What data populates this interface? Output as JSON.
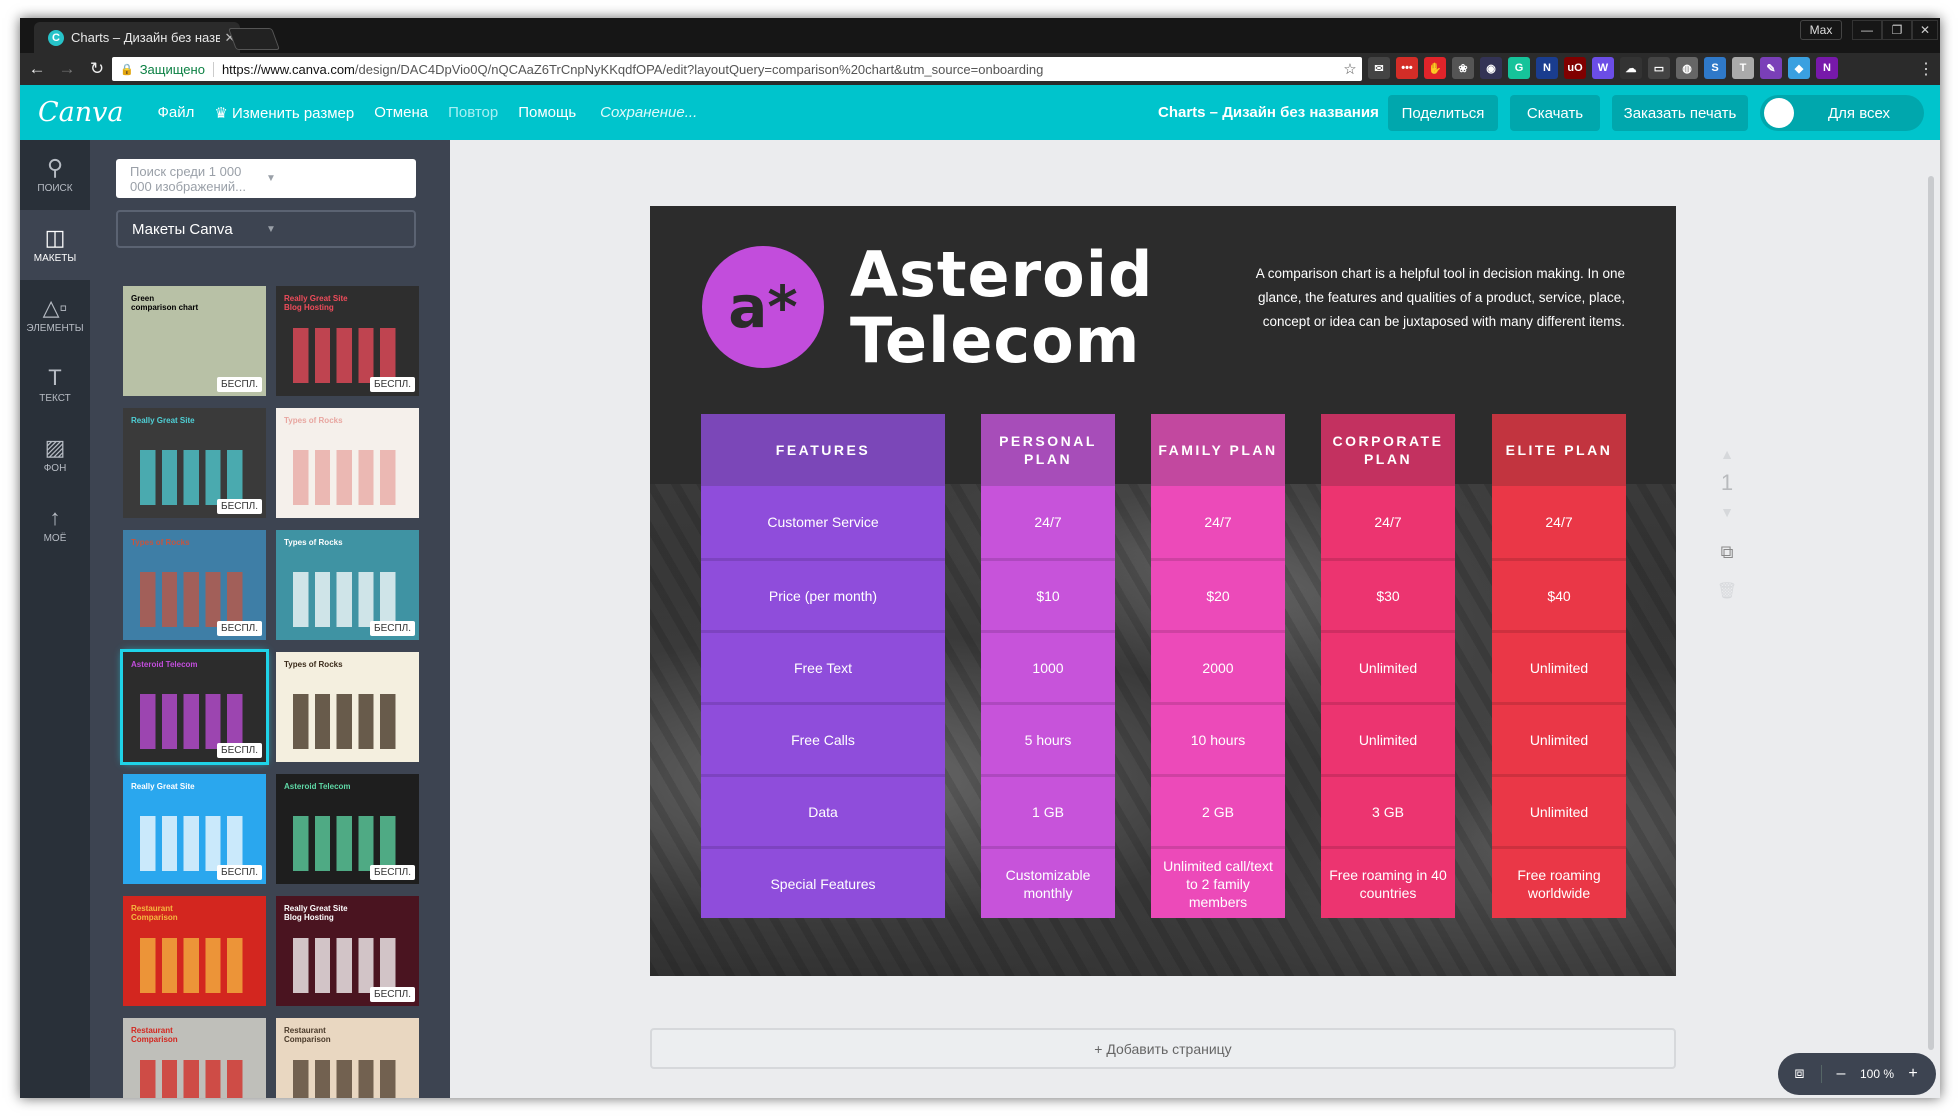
{
  "browser": {
    "tab_title": "Charts – Дизайн без назв",
    "tab_favicon": "C",
    "profile": "Max",
    "window_controls": [
      "minimize-icon",
      "restore-icon",
      "close-icon"
    ],
    "secure_label": "Защищено",
    "url_host": "https://www.canva.com",
    "url_path": "/design/DAC4DpVio0Q/nQCAaZ6TrCnpNyKKqdfOPA/edit?layoutQuery=comparison%20chart&utm_source=onboarding",
    "extensions": [
      {
        "name": "mail-ext-icon",
        "glyph": "✉",
        "color": "#444"
      },
      {
        "name": "lastpass-ext-icon",
        "glyph": "•••",
        "color": "#d32d27"
      },
      {
        "name": "adblock-ext-icon",
        "glyph": "✋",
        "color": "#e0242a"
      },
      {
        "name": "paw-ext-icon",
        "glyph": "❀",
        "color": "#555"
      },
      {
        "name": "spy-ext-icon",
        "glyph": "◉",
        "color": "#335"
      },
      {
        "name": "grammarly-ext-icon",
        "glyph": "G",
        "color": "#15c39a"
      },
      {
        "name": "n-ext-icon",
        "glyph": "N",
        "color": "#1a3d8f"
      },
      {
        "name": "ublock-ext-icon",
        "glyph": "uO",
        "color": "#800000"
      },
      {
        "name": "w-ext-icon",
        "glyph": "W",
        "color": "#6b4de6"
      },
      {
        "name": "cloud-ext-icon",
        "glyph": "☁",
        "color": "#333"
      },
      {
        "name": "window-ext-icon",
        "glyph": "▭",
        "color": "#444"
      },
      {
        "name": "globe-ext-icon",
        "glyph": "◍",
        "color": "#666"
      },
      {
        "name": "s-ext-icon",
        "glyph": "S",
        "color": "#2f79c9"
      },
      {
        "name": "t-ext-icon",
        "glyph": "T",
        "color": "#aaa"
      },
      {
        "name": "feather-ext-icon",
        "glyph": "✎",
        "color": "#7a3fb8"
      },
      {
        "name": "diamond-ext-icon",
        "glyph": "◆",
        "color": "#3aa0e0"
      },
      {
        "name": "onenote-ext-icon",
        "glyph": "N",
        "color": "#7719aa"
      }
    ]
  },
  "header": {
    "logo": "Canva",
    "menu": [
      "Файл",
      "Изменить размер",
      "Отмена",
      "Повтор",
      "Помощь"
    ],
    "status": "Сохранение...",
    "doc_title": "Charts – Дизайн без названия",
    "share": "Поделиться",
    "download": "Скачать",
    "print": "Заказать печать",
    "visibility": "Для всех"
  },
  "rail": [
    {
      "label": "ПОИСК",
      "icon": "search-icon",
      "glyph": "⚲"
    },
    {
      "label": "МАКЕТЫ",
      "icon": "layouts-icon",
      "glyph": "◫",
      "active": true
    },
    {
      "label": "ЭЛЕМЕНТЫ",
      "icon": "elements-icon",
      "glyph": "△▫"
    },
    {
      "label": "ТЕКСТ",
      "icon": "text-icon",
      "glyph": "T"
    },
    {
      "label": "ФОН",
      "icon": "background-icon",
      "glyph": "▨"
    },
    {
      "label": "МОЁ",
      "icon": "upload-icon",
      "glyph": "↑"
    }
  ],
  "panel": {
    "search_placeholder": "Поиск среди 1 000 000 изображений...",
    "dropdown": "Макеты Canva",
    "badge": "БЕСПЛ.",
    "templates": [
      {
        "title": "Green comparison chart",
        "bg": "#b8c1a6",
        "free": true
      },
      {
        "title": "Really Great Site Blog Hosting",
        "bg": "#2e2e2e",
        "accent": "#ef4c5b",
        "free": true
      },
      {
        "title": "Really Great Site",
        "bg": "#3a3a3a",
        "accent": "#4fd0d6",
        "free": true
      },
      {
        "title": "Types of Rocks",
        "bg": "#f5f0eb",
        "accent": "#e8a6a0",
        "free": false
      },
      {
        "title": "Types of Rocks",
        "bg": "#3e7ea6",
        "accent": "#c4553f",
        "free": true
      },
      {
        "title": "Types of Rocks",
        "bg": "#3f93a3",
        "accent": "#fff",
        "free": true
      },
      {
        "title": "Asteroid Telecom",
        "bg": "#2c2c2c",
        "accent": "#c24ddc",
        "free": true,
        "selected": true
      },
      {
        "title": "Types of Rocks",
        "bg": "#f4efdf",
        "accent": "#3a2a1a",
        "free": false
      },
      {
        "title": "Really Great Site",
        "bg": "#2aa7ee",
        "accent": "#fff",
        "free": true
      },
      {
        "title": "Asteroid Telecom",
        "bg": "#1e1e1e",
        "accent": "#5fd8a6",
        "free": true
      },
      {
        "title": "Restaurant Comparison",
        "bg": "#d3261f",
        "accent": "#f5b940",
        "free": false
      },
      {
        "title": "Really Great Site Blog Hosting",
        "bg": "#4a1420",
        "accent": "#fff",
        "free": true
      },
      {
        "title": "Restaurant Comparison",
        "bg": "#bfbfba",
        "accent": "#d3261f",
        "free": false
      },
      {
        "title": "Restaurant Comparison",
        "bg": "#e9d7c1",
        "accent": "#4a3a2a",
        "free": false
      }
    ]
  },
  "design": {
    "logo_text": "a*",
    "brand_line1": "Asteroid",
    "brand_line2": "Telecom",
    "description": "A comparison chart is a helpful tool in decision making. In one glance, the features and qualities of a product, service, place, concept or idea can be juxtaposed with many different items.",
    "columns": [
      {
        "header": "FEATURES",
        "head_color": "#7b47b8",
        "cell_color": "#8f4ddb",
        "cells": [
          "Customer Service",
          "Price (per month)",
          "Free Text",
          "Free Calls",
          "Data",
          "Special Features"
        ]
      },
      {
        "header": "PERSONAL PLAN",
        "head_color": "#a74db9",
        "cell_color": "#c753da",
        "cells": [
          "24/7",
          "$10",
          "1000",
          "5 hours",
          "1 GB",
          "Customizable monthly"
        ]
      },
      {
        "header": "FAMILY PLAN",
        "head_color": "#c2489f",
        "cell_color": "#ec4ab9",
        "cells": [
          "24/7",
          "$20",
          "2000",
          "10 hours",
          "2 GB",
          "Unlimited call/text to 2 family members"
        ]
      },
      {
        "header": "CORPORATE PLAN",
        "head_color": "#c33160",
        "cell_color": "#ec3470",
        "cells": [
          "24/7",
          "$30",
          "Unlimited",
          "Unlimited",
          "3 GB",
          "Free roaming in 40 countries"
        ]
      },
      {
        "header": "ELITE PLAN",
        "head_color": "#c2343f",
        "cell_color": "#ea3747",
        "cells": [
          "24/7",
          "$40",
          "Unlimited",
          "Unlimited",
          "Unlimited",
          "Free roaming worldwide"
        ]
      }
    ]
  },
  "page_controls": {
    "page_number": "1"
  },
  "add_page": "+ Добавить страницу",
  "zoom": {
    "value": "100 %",
    "minus": "–",
    "plus": "+"
  }
}
